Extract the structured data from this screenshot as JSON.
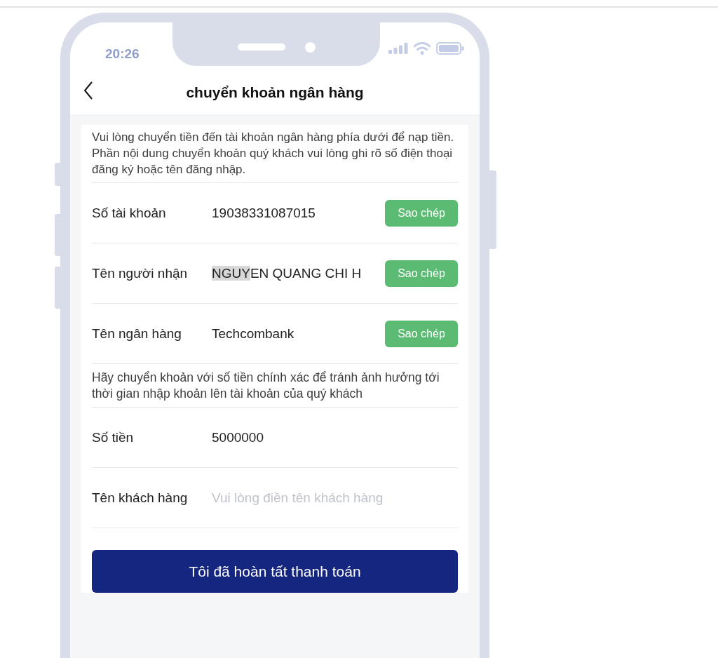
{
  "status_bar": {
    "time": "20:26"
  },
  "header": {
    "title": "chuyển khoản ngân hàng"
  },
  "intro": "Vui lòng chuyển tiền đến tài khoản ngân hàng phía dưới để nạp tiền. Phần nội dung chuyển khoản quý khách vui lòng ghi rõ số điện thoại đăng ký hoặc tên đăng nhập.",
  "rows": [
    {
      "kind": "copy",
      "label": "Số tài khoản",
      "value": "19038331087015",
      "button": "Sao chép"
    },
    {
      "kind": "copy",
      "label": "Tên người nhận",
      "value_selected": "NGUY",
      "value": "EN QUANG CHI H",
      "button": "Sao chép"
    },
    {
      "kind": "copy",
      "label": "Tên ngân hàng",
      "value": "Techcombank",
      "button": "Sao chép"
    },
    {
      "kind": "note",
      "text": "Hãy chuyển khoản với số tiền chính xác để tránh ảnh hưởng tới thời gian nhập khoản lên tài khoản của quý khách"
    },
    {
      "kind": "plain",
      "label": "Số tiền",
      "value": "5000000"
    },
    {
      "kind": "input",
      "label": "Tên khách hàng",
      "placeholder": "Vui lòng điền tên khách hàng"
    }
  ],
  "submit": "Tôi đã hoàn tất thanh toán"
}
